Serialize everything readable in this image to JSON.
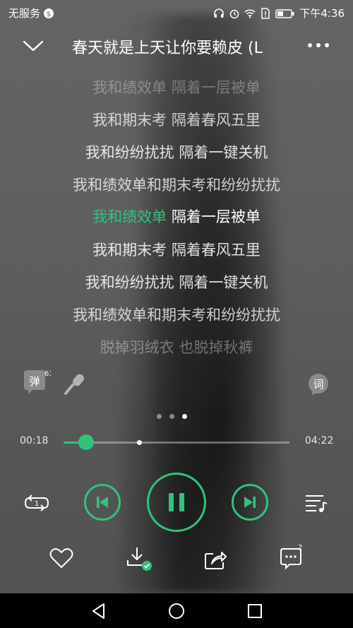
{
  "status_bar": {
    "carrier": "无服务",
    "time": "下午4:36"
  },
  "header": {
    "song_title": "春天就是上天让你要赖皮 (L"
  },
  "lyrics": [
    {
      "text": "我和绩效单 隔着一层被单",
      "highlight": "",
      "state": "fade"
    },
    {
      "text": "我和期末考 隔着春风五里",
      "highlight": "",
      "state": "normal"
    },
    {
      "text": "我和纷纷扰扰 隔着一键关机",
      "highlight": "",
      "state": "normal"
    },
    {
      "text": "我和绩效单和期末考和纷纷扰扰",
      "highlight": "",
      "state": "normal"
    },
    {
      "text": " 隔着一层被单",
      "highlight": "我和绩效单",
      "state": "current"
    },
    {
      "text": "我和期末考 隔着春风五里",
      "highlight": "",
      "state": "normal"
    },
    {
      "text": "我和纷纷扰扰 隔着一键关机",
      "highlight": "",
      "state": "normal"
    },
    {
      "text": "我和绩效单和期末考和纷纷扰扰",
      "highlight": "",
      "state": "normal"
    },
    {
      "text": "脱掉羽绒衣 也脱掉秋裤",
      "highlight": "",
      "state": "fade"
    }
  ],
  "tools": {
    "danmaku_label": "弹",
    "danmaku_count": "63",
    "lyrics_label": "词"
  },
  "pager": {
    "pages": 3,
    "active": 2
  },
  "progress": {
    "elapsed": "00:18",
    "total": "04:22",
    "played_fraction": 0.1,
    "buffered_fraction": 0.335
  },
  "actions": {
    "comment_count": "2"
  },
  "colors": {
    "accent": "#31c27c"
  }
}
